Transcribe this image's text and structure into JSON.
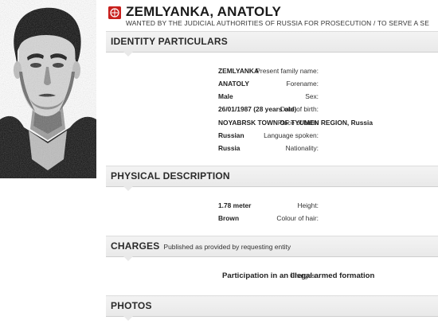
{
  "header": {
    "name": "ZEMLYANKA, ANATOLY",
    "wanted_by": "WANTED BY THE JUDICIAL AUTHORITIES OF RUSSIA FOR PROSECUTION / TO SERVE A SE",
    "emblem_icon": "interpol-emblem-icon",
    "emblem_color": "#c8201e"
  },
  "identity": {
    "title": "IDENTITY PARTICULARS",
    "fields": [
      {
        "label": "Present family name:",
        "value": "ZEMLYANKA"
      },
      {
        "label": "Forename:",
        "value": "ANATOLY"
      },
      {
        "label": "Sex:",
        "value": "Male"
      },
      {
        "label": "Date of birth:",
        "value": "26/01/1987 (28 years old)"
      },
      {
        "label": "Place of birth:",
        "value": "NOYABRSK TOWN OF TYUMEN REGION, Russia"
      },
      {
        "label": "Language spoken:",
        "value": "Russian"
      },
      {
        "label": "Nationality:",
        "value": "Russia"
      }
    ]
  },
  "physical": {
    "title": "PHYSICAL DESCRIPTION",
    "fields": [
      {
        "label": "Height:",
        "value": "1.78 meter"
      },
      {
        "label": "Colour of hair:",
        "value": "Brown"
      }
    ]
  },
  "charges": {
    "title": "CHARGES",
    "subtitle": "Published as provided by requesting entity",
    "fields": [
      {
        "label": "Charges:",
        "value": "Participation in an illegal armed formation"
      }
    ]
  },
  "photos": {
    "title": "PHOTOS"
  }
}
